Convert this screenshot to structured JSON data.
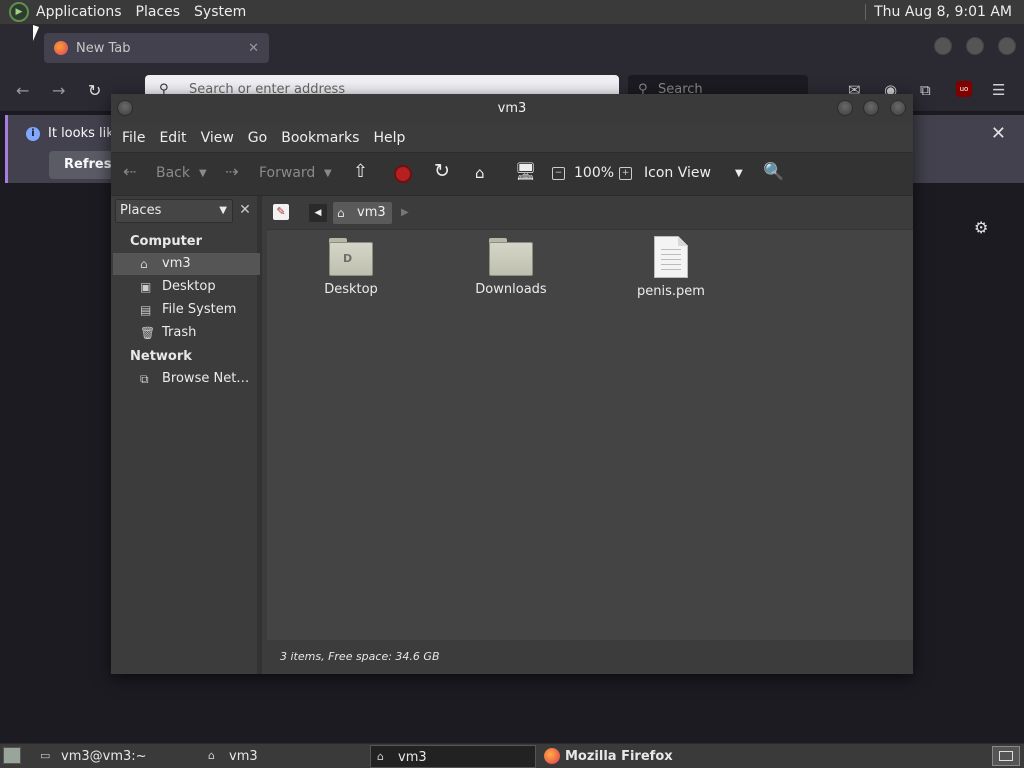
{
  "top_panel": {
    "menus": [
      "Applications",
      "Places",
      "System"
    ],
    "clock": "Thu Aug  8,  9:01 AM"
  },
  "firefox": {
    "tab_title": "New Tab",
    "tab_close": "✕",
    "url_placeholder": "Search or enter address",
    "search_placeholder": "Search",
    "notice_text": "It looks like",
    "refresh_label": "Refresh",
    "notice_close": "✕"
  },
  "caja": {
    "title": "vm3",
    "menus": [
      "File",
      "Edit",
      "View",
      "Go",
      "Bookmarks",
      "Help"
    ],
    "toolbar": {
      "back": "Back",
      "forward": "Forward",
      "zoom": "100%",
      "view_mode": "Icon View"
    },
    "sidebar": {
      "combo": "Places",
      "sections": [
        {
          "title": "Computer",
          "items": [
            {
              "label": "vm3",
              "icon": "home-folder-icon",
              "selected": true
            },
            {
              "label": "Desktop",
              "icon": "desktop-folder-icon"
            },
            {
              "label": "File System",
              "icon": "drive-icon"
            },
            {
              "label": "Trash",
              "icon": "trash-icon"
            }
          ]
        },
        {
          "title": "Network",
          "items": [
            {
              "label": "Browse Net…",
              "icon": "network-icon"
            }
          ]
        }
      ]
    },
    "pathbar": {
      "current": "vm3"
    },
    "files": [
      {
        "name": "Desktop",
        "type": "folder",
        "emblem": "D"
      },
      {
        "name": "Downloads",
        "type": "folder",
        "emblem": ""
      },
      {
        "name": "penis.pem",
        "type": "file"
      }
    ],
    "status": "3 items, Free space: 34.6 GB"
  },
  "taskbar": {
    "tasks": [
      {
        "label": "vm3@vm3:~",
        "icon": "terminal-icon"
      },
      {
        "label": "vm3",
        "icon": "folder-icon"
      },
      {
        "label": "vm3",
        "icon": "folder-icon",
        "active": true
      },
      {
        "label": "Mozilla Firefox",
        "icon": "firefox-icon",
        "bold": true
      }
    ]
  }
}
